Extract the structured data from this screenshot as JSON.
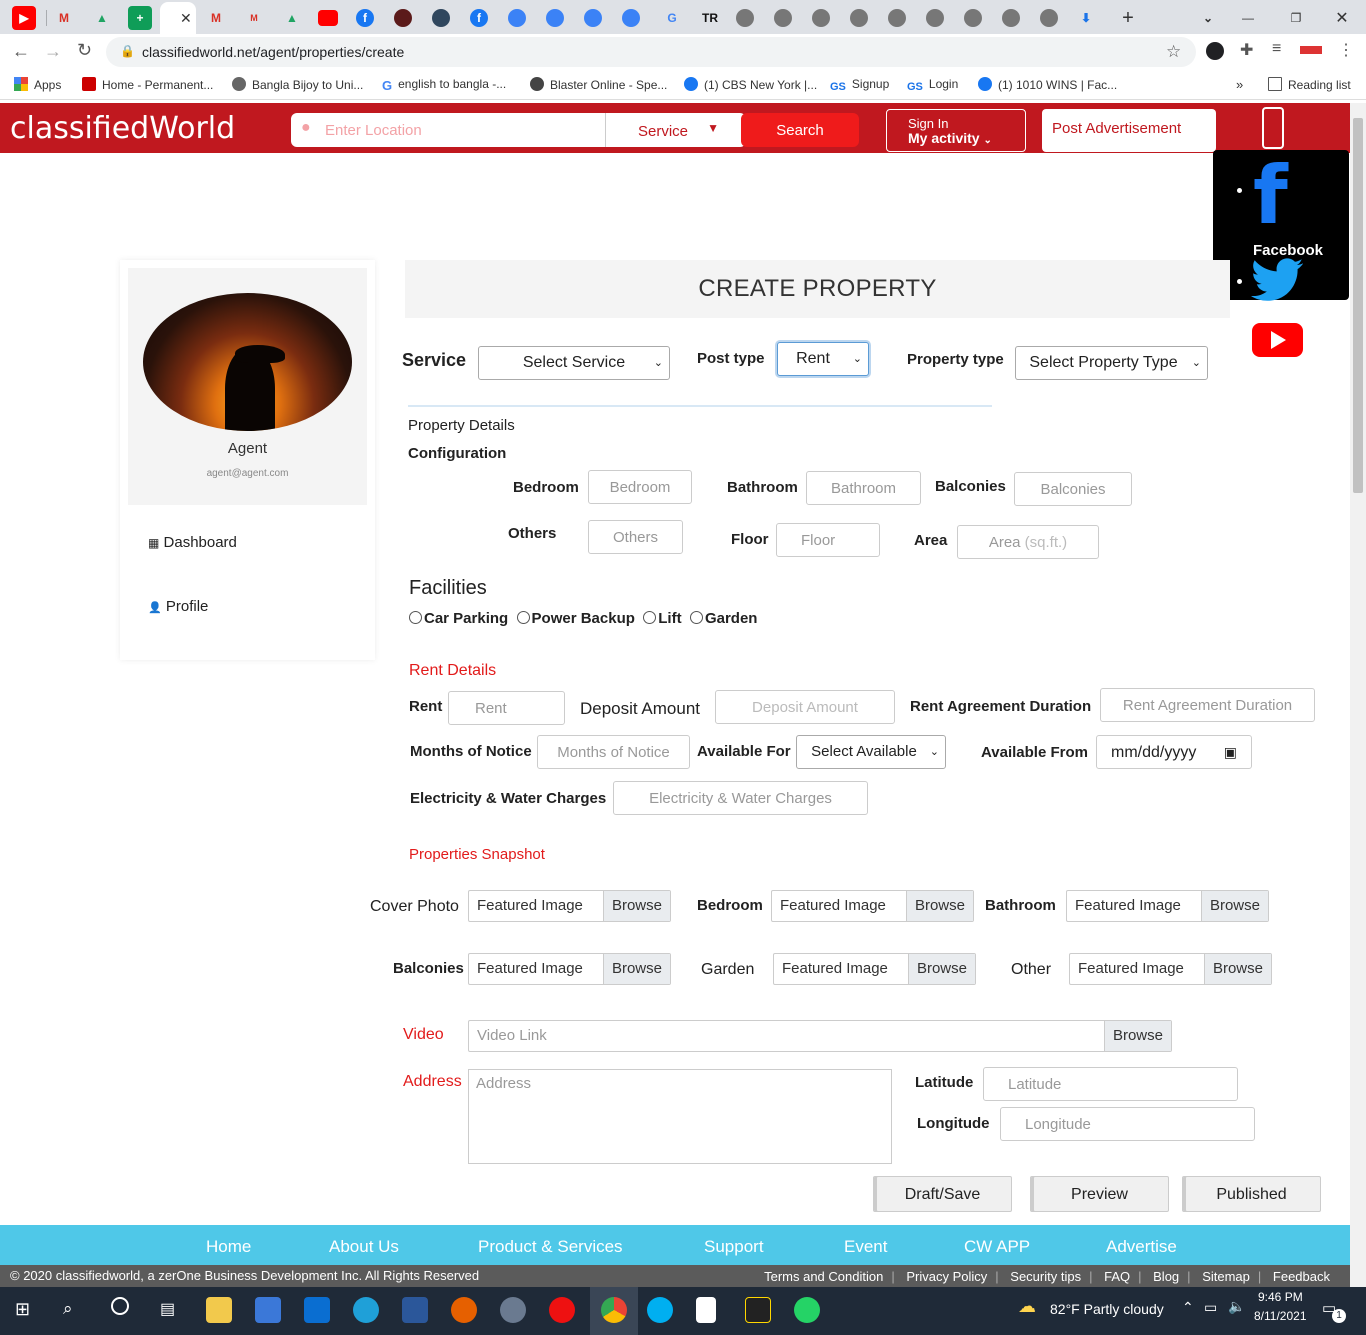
{
  "browser": {
    "url": "classifiedworld.net/agent/properties/create",
    "bookmarks": [
      "Apps",
      "Home - Permanent...",
      "Bangla Bijoy to Uni...",
      "english to bangla -...",
      "Blaster Online - Spe...",
      "(1) CBS New York |...",
      "Signup",
      "Login",
      "(1) 1010 WINS | Fac..."
    ],
    "reading_list": "Reading list",
    "more_bookmarks": "»"
  },
  "header": {
    "logo": "classifiedWorld",
    "location_placeholder": "Enter Location",
    "service_select": "Service",
    "search_button": "Search",
    "sign_in": "Sign In",
    "my_activity": "My activity",
    "post_ad": "Post Advertisement",
    "brand_color": "#c0181f"
  },
  "social": {
    "facebook": "Facebook"
  },
  "sidebar": {
    "name": "Agent",
    "email": "agent@agent.com",
    "menu": [
      {
        "label": "Dashboard",
        "icon": "dashboard-icon"
      },
      {
        "label": "Profile",
        "icon": "user-icon"
      }
    ]
  },
  "form": {
    "title": "CREATE PROPERTY",
    "service_label": "Service",
    "service_value": "Select Service",
    "post_type_label": "Post type",
    "post_type_value": "Rent",
    "property_type_label": "Property type",
    "property_type_value": "Select Property Type",
    "property_details": "Property Details",
    "configuration": "Configuration",
    "bedroom_label": "Bedroom",
    "bedroom_ph": "Bedroom",
    "bathroom_label": "Bathroom",
    "bathroom_ph": "Bathroom",
    "balconies_label": "Balconies",
    "balconies_ph": "Balconies",
    "others_label": "Others",
    "others_ph": "Others",
    "floor_label": "Floor",
    "floor_ph": "Floor",
    "area_label": "Area",
    "area_ph": "Area",
    "area_unit": "(sq.ft.)",
    "facilities": "Facilities",
    "facility_options": [
      "Car Parking",
      "Power Backup",
      "Lift",
      "Garden"
    ],
    "rent_details": "Rent Details",
    "rent_label": "Rent",
    "rent_ph": "Rent",
    "deposit_label": "Deposit Amount",
    "deposit_ph": "Deposit Amount",
    "agreement_label": "Rent Agreement Duration",
    "agreement_ph": "Rent Agreement Duration",
    "notice_label": "Months of Notice",
    "notice_ph": "Months of Notice",
    "available_for_label": "Available For",
    "available_for_value": "Select Available",
    "available_from_label": "Available From",
    "available_from_value": "mm/dd/yyyy",
    "charges_label": "Electricity & Water Charges",
    "charges_ph": "Electricity & Water Charges",
    "snapshot": "Properties Snapshot",
    "photos": [
      {
        "label": "Cover Photo"
      },
      {
        "label": "Bedroom"
      },
      {
        "label": "Bathroom"
      },
      {
        "label": "Balconies"
      },
      {
        "label": "Garden"
      },
      {
        "label": "Other"
      }
    ],
    "featured_image": "Featured Image",
    "browse": "Browse",
    "video_label": "Video",
    "video_ph": "Video Link",
    "address_label": "Address",
    "address_ph": "Address",
    "latitude_label": "Latitude",
    "latitude_ph": "Latitude",
    "longitude_label": "Longitude",
    "longitude_ph": "Longitude",
    "draft_button": "Draft/Save",
    "preview_button": "Preview",
    "publish_button": "Published"
  },
  "footer": {
    "nav": [
      "Home",
      "About Us",
      "Product & Services",
      "Support",
      "Event",
      "CW APP",
      "Advertise"
    ],
    "copyright": "© 2020 classifiedworld, a zerOne Business Development Inc. All Rights Reserved",
    "links": [
      "Terms and Condition",
      "Privacy Policy",
      "Security tips",
      "FAQ",
      "Blog",
      "Sitemap",
      "Feedback"
    ],
    "nav_color": "#4fc8e8"
  },
  "taskbar": {
    "weather": "82°F  Partly cloudy",
    "time": "9:46 PM",
    "date": "8/11/2021",
    "notifications": "1"
  }
}
